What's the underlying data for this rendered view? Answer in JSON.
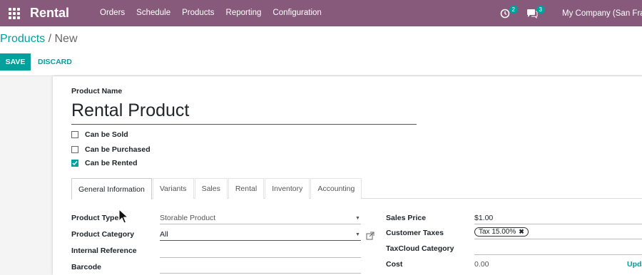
{
  "navbar": {
    "app_title": "Rental",
    "menu": [
      "Orders",
      "Schedule",
      "Products",
      "Reporting",
      "Configuration"
    ],
    "activity_badge": "2",
    "messages_badge": "3",
    "company": "My Company (San Francisco)",
    "color": "#875a7b"
  },
  "breadcrumb": {
    "parent": "Products",
    "separator": "/",
    "current": "New"
  },
  "buttons": {
    "save": "SAVE",
    "discard": "DISCARD"
  },
  "form": {
    "name_label": "Product Name",
    "name_value": "Rental Product",
    "checkboxes": [
      {
        "label": "Can be Sold",
        "checked": false
      },
      {
        "label": "Can be Purchased",
        "checked": false
      },
      {
        "label": "Can be Rented",
        "checked": true
      }
    ],
    "tabs": [
      "General Information",
      "Variants",
      "Sales",
      "Rental",
      "Inventory",
      "Accounting"
    ],
    "left_fields": {
      "product_type_label": "Product Type",
      "product_type_value": "Storable Product",
      "product_category_label": "Product Category",
      "product_category_value": "All",
      "internal_reference_label": "Internal Reference",
      "barcode_label": "Barcode"
    },
    "right_fields": {
      "sales_price_label": "Sales Price",
      "sales_price_value": "$1.00",
      "customer_taxes_label": "Customer Taxes",
      "tax_tag": "Tax 15.00%",
      "taxcloud_label": "TaxCloud Category",
      "cost_label": "Cost",
      "cost_value": "0.00",
      "update_link": "Upda"
    }
  },
  "accent_color": "#00a09d"
}
